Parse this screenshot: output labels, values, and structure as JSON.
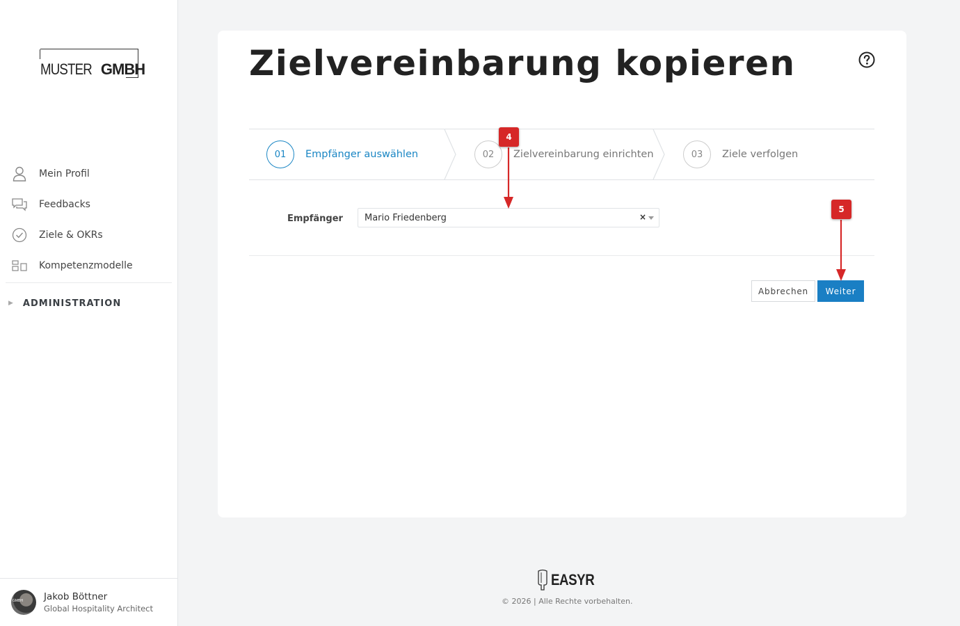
{
  "sidebar": {
    "logo": {
      "part1": "MUSTER",
      "part2": "GMBH"
    },
    "items": [
      {
        "label": "Mein Profil",
        "icon": "user-icon"
      },
      {
        "label": "Feedbacks",
        "icon": "chat-bubbles-icon"
      },
      {
        "label": "Ziele & OKRs",
        "icon": "check-circle-icon"
      },
      {
        "label": "Kompetenzmodelle",
        "icon": "grid-blocks-icon"
      }
    ],
    "admin_label": "ADMINISTRATION",
    "user": {
      "name": "Jakob Böttner",
      "role": "Global Hospitality Architect"
    }
  },
  "main": {
    "title": "Zielvereinbarung kopieren",
    "steps": [
      {
        "number": "01",
        "label": "Empfänger auswählen",
        "active": true
      },
      {
        "number": "02",
        "label": "Zielvereinbarung einrichten",
        "active": false
      },
      {
        "number": "03",
        "label": "Ziele verfolgen",
        "active": false
      }
    ],
    "form": {
      "recipient_label": "Empfänger",
      "recipient_value": "Mario Friedenberg",
      "clear_symbol": "×"
    },
    "buttons": {
      "cancel": "Abbrechen",
      "next": "Weiter"
    }
  },
  "annotations": [
    {
      "label": "4"
    },
    {
      "label": "5"
    }
  ],
  "footer": {
    "brand": "EASYR",
    "copyright": "© 2026 | Alle Rechte vorbehalten."
  },
  "colors": {
    "accent": "#1a7fc4",
    "marker": "#d62828",
    "background": "#f3f4f5"
  }
}
